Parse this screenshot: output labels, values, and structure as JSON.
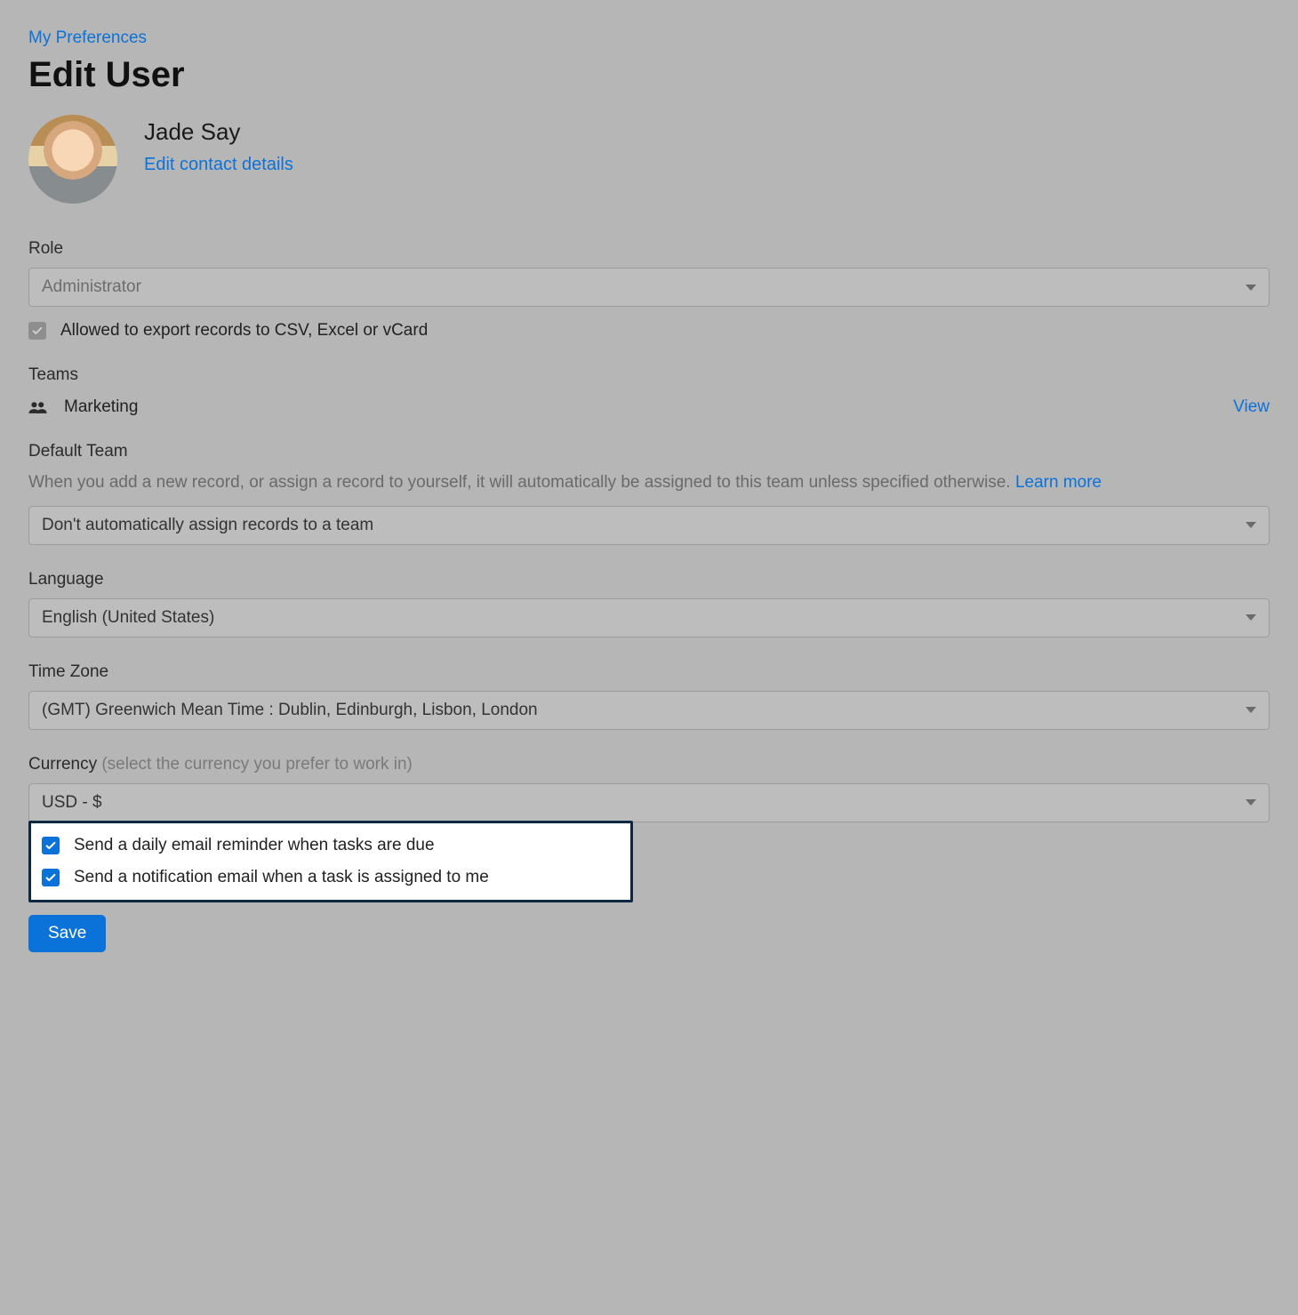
{
  "breadcrumb": "My Preferences",
  "page_title": "Edit User",
  "user": {
    "name": "Jade Say",
    "edit_contact_label": "Edit contact details"
  },
  "role": {
    "label": "Role",
    "value": "Administrator",
    "export_checkbox_label": "Allowed to export records to CSV, Excel or vCard",
    "export_checked": true
  },
  "teams": {
    "label": "Teams",
    "items": [
      {
        "name": "Marketing",
        "view_label": "View"
      }
    ]
  },
  "default_team": {
    "label": "Default Team",
    "description": "When you add a new record, or assign a record to yourself, it will automatically be assigned to this team unless specified otherwise.",
    "learn_more_label": "Learn more",
    "value": "Don't automatically assign records to a team"
  },
  "language": {
    "label": "Language",
    "value": "English (United States)"
  },
  "timezone": {
    "label": "Time Zone",
    "value": "(GMT) Greenwich Mean Time : Dublin, Edinburgh, Lisbon, London"
  },
  "currency": {
    "label": "Currency",
    "hint": "(select the currency you prefer to work in)",
    "value": "USD - $"
  },
  "notifications": {
    "daily_reminder_label": "Send a daily email reminder when tasks are due",
    "daily_reminder_checked": true,
    "assigned_notify_label": "Send a notification email when a task is assigned to me",
    "assigned_notify_checked": true
  },
  "save_label": "Save"
}
